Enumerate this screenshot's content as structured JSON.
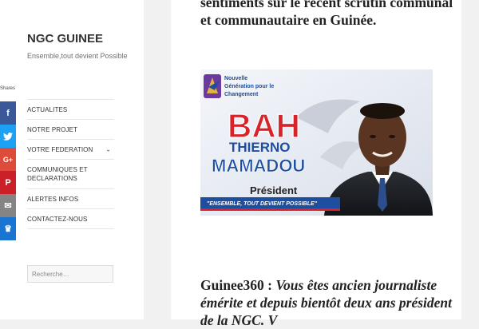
{
  "site": {
    "title": "NGC GUINEE",
    "description": "Ensemble,tout devient Possible"
  },
  "share": {
    "label": "Shares",
    "buttons": [
      {
        "name": "facebook",
        "glyph": "f",
        "color": "#3b5998"
      },
      {
        "name": "twitter",
        "glyph": "t",
        "color": "#1da1f2"
      },
      {
        "name": "google-plus",
        "glyph": "G+",
        "color": "#dd4b39"
      },
      {
        "name": "pinterest",
        "glyph": "P",
        "color": "#cb2027"
      },
      {
        "name": "email",
        "glyph": "✉",
        "color": "#848484"
      },
      {
        "name": "sumo-crown",
        "glyph": "♛",
        "color": "#1a74d2"
      }
    ]
  },
  "nav": {
    "items": [
      {
        "label": "ACTUALITES"
      },
      {
        "label": "NOTRE PROJET"
      },
      {
        "label": "VOTRE FEDERATION",
        "has_submenu": true
      },
      {
        "label": "COMMUNIQUES ET DECLARATIONS"
      },
      {
        "label": "ALERTES INFOS"
      },
      {
        "label": "CONTACTEZ-NOUS"
      }
    ]
  },
  "search": {
    "placeholder": "Recherche…"
  },
  "article": {
    "headline": "sentiments sur le récent scrutin communal et communautaire en Guinée.",
    "question_source": "Guinee360 :",
    "question_text": "Vous êtes ancien journaliste émérite et depuis bientôt",
    "question_tail": "deux ans président de la NGC. V"
  },
  "banner": {
    "logo_line1": "Nouvelle",
    "logo_line2": "Génération pour le",
    "logo_line3": "Changement",
    "name_big": "BAH",
    "name_mid": "THIERNO",
    "name_last": "MAMADOU",
    "role": "Président",
    "slogan": "\"ENSEMBLE, TOUT DEVIENT POSSIBLE\"",
    "colors": {
      "red": "#d8232a",
      "blue": "#1d4ea0",
      "gold": "#e3b23c",
      "purple": "#6a3aa0"
    }
  }
}
